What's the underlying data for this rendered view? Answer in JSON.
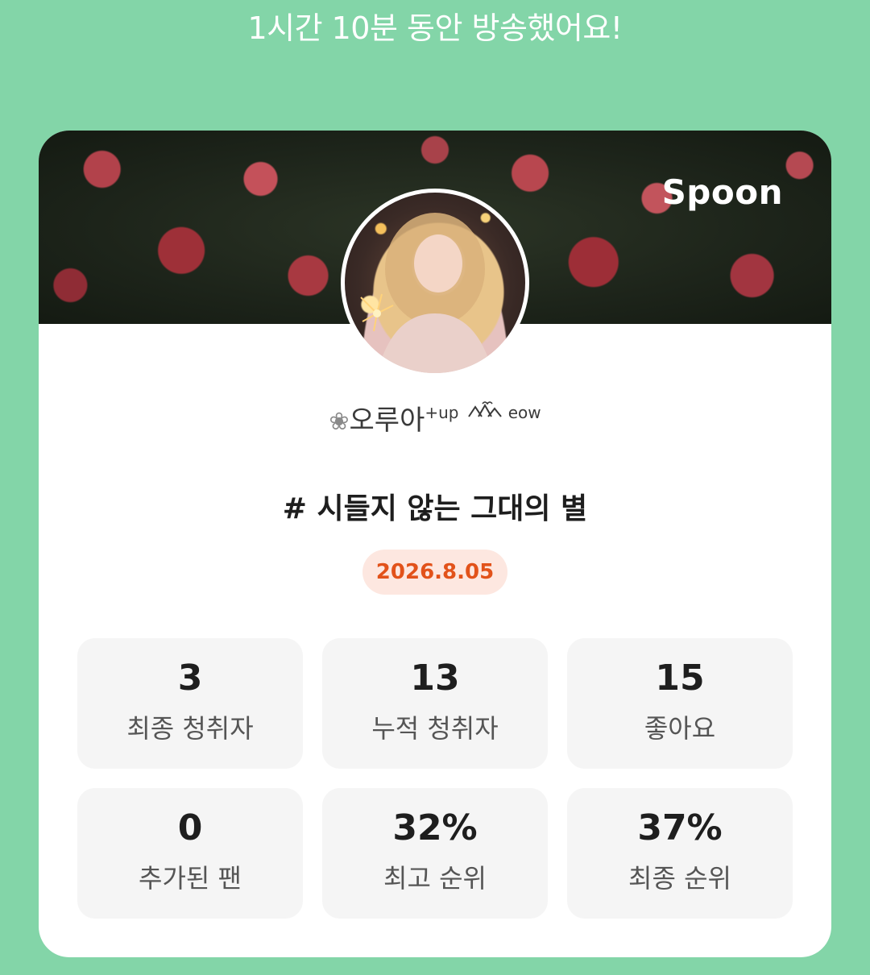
{
  "header": {
    "message": "1시간 10분 동안 방송했어요!"
  },
  "card": {
    "brand": "Spoon",
    "user": {
      "prefix_icon": "flower-icon",
      "name": "오루아",
      "name_suffix": "+up",
      "tag_icon": "cat-ears-icon",
      "tag": "eow"
    },
    "title": "# 시들지 않는 그대의 별",
    "date": "2026.8.05",
    "stats": [
      {
        "value": "3",
        "label": "최종 청취자"
      },
      {
        "value": "13",
        "label": "누적 청취자"
      },
      {
        "value": "15",
        "label": "좋아요"
      },
      {
        "value": "0",
        "label": "추가된 팬"
      },
      {
        "value": "32%",
        "label": "최고 순위"
      },
      {
        "value": "37%",
        "label": "최종 순위"
      }
    ]
  },
  "colors": {
    "background": "#83d5a8",
    "card": "#ffffff",
    "date_text": "#e2521a",
    "date_pill": "#fde7e0",
    "stat_tile": "#f5f5f5"
  }
}
